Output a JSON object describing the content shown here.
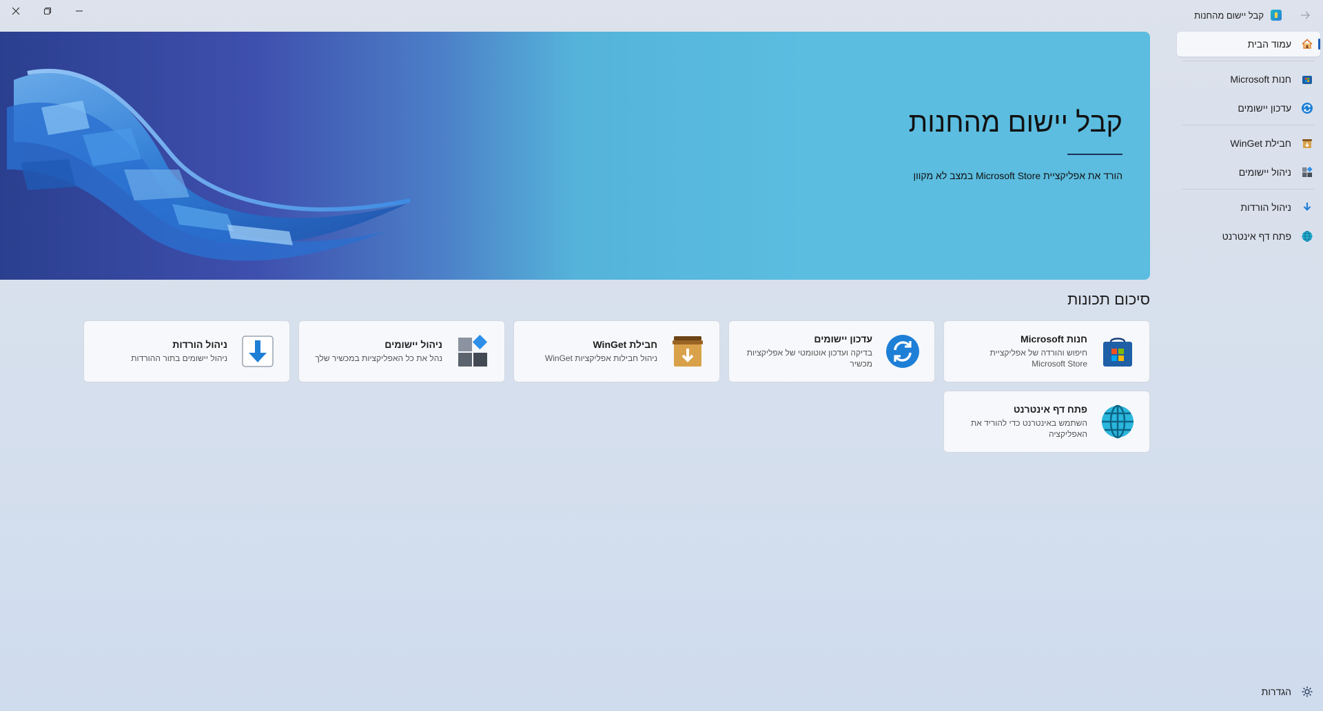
{
  "window": {
    "title": "קבל יישום מהחנות",
    "caption_minimize": "minimize",
    "caption_restore": "restore",
    "caption_close": "close"
  },
  "sidebar": {
    "items": [
      {
        "label": "עמוד הבית",
        "icon": "home-icon",
        "selected": true
      },
      {
        "label": "חנות Microsoft",
        "icon": "store-icon"
      },
      {
        "label": "עדכון יישומים",
        "icon": "refresh-icon"
      },
      {
        "label": "חבילת WinGet",
        "icon": "package-icon"
      },
      {
        "label": "ניהול יישומים",
        "icon": "apps-icon"
      },
      {
        "label": "ניהול הורדות",
        "icon": "download-icon"
      },
      {
        "label": "פתח דף אינטרנט",
        "icon": "globe-icon"
      }
    ],
    "settings_label": "הגדרות"
  },
  "hero": {
    "title": "קבל יישום מהחנות",
    "subtitle": "הורד את אפליקציית Microsoft Store במצב לא מקוון"
  },
  "section": {
    "title": "סיכום תכונות"
  },
  "cards": [
    {
      "title": "חנות Microsoft",
      "desc": "חיפוש והורדה של אפליקציית Microsoft Store",
      "icon": "store-icon"
    },
    {
      "title": "עדכון יישומים",
      "desc": "בדיקה ועדכון אוטומטי של אפליקציות מכשיר",
      "icon": "refresh-icon"
    },
    {
      "title": "חבילת WinGet",
      "desc": "ניהול חבילות אפליקציות WinGet",
      "icon": "package-icon"
    },
    {
      "title": "ניהול יישומים",
      "desc": "נהל את כל האפליקציות במכשיר שלך",
      "icon": "apps-icon"
    },
    {
      "title": "ניהול הורדות",
      "desc": "ניהול יישומים בתור ההורדות",
      "icon": "download-icon"
    },
    {
      "title": "פתח דף אינטרנט",
      "desc": "השתמש באינטרנט כדי להוריד את האפליקציה",
      "icon": "globe-icon"
    }
  ],
  "colors": {
    "accent": "#1a5fb4",
    "hero_left": "#2b3f8f",
    "hero_right": "#5cbde0",
    "card_bg": "#f7f8fb"
  }
}
